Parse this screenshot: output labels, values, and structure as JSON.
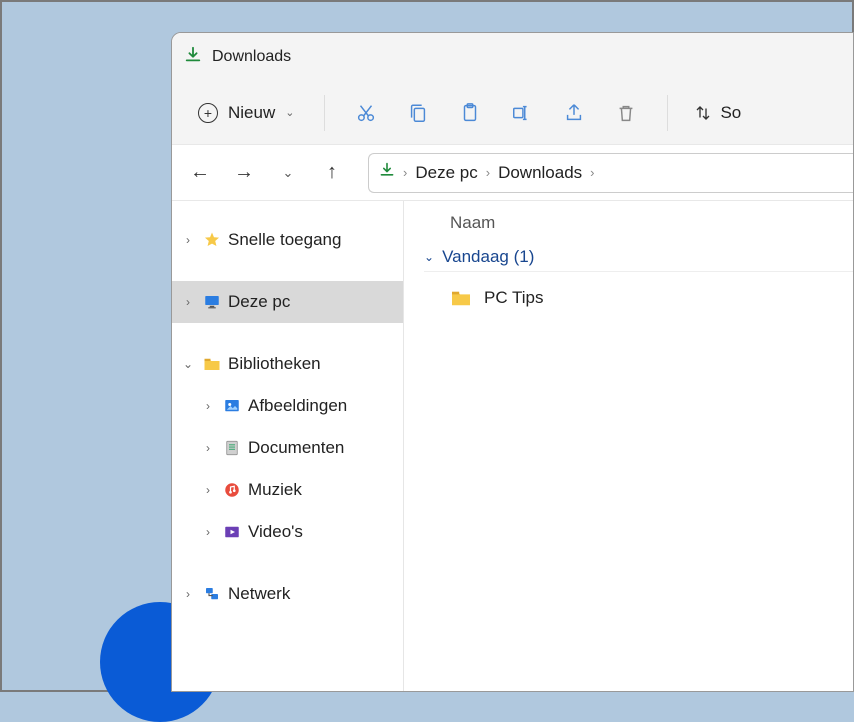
{
  "titlebar": {
    "title": "Downloads"
  },
  "toolbar": {
    "new_label": "Nieuw",
    "sort_label": "So"
  },
  "breadcrumbs": {
    "root": "Deze pc",
    "current": "Downloads"
  },
  "sidebar": {
    "quick_access": "Snelle toegang",
    "this_pc": "Deze pc",
    "libraries": "Bibliotheken",
    "pictures": "Afbeeldingen",
    "documents": "Documenten",
    "music": "Muziek",
    "videos": "Video's",
    "network": "Netwerk"
  },
  "main": {
    "column_name": "Naam",
    "group_today": "Vandaag (1)",
    "items": [
      {
        "name": "PC Tips"
      }
    ]
  }
}
